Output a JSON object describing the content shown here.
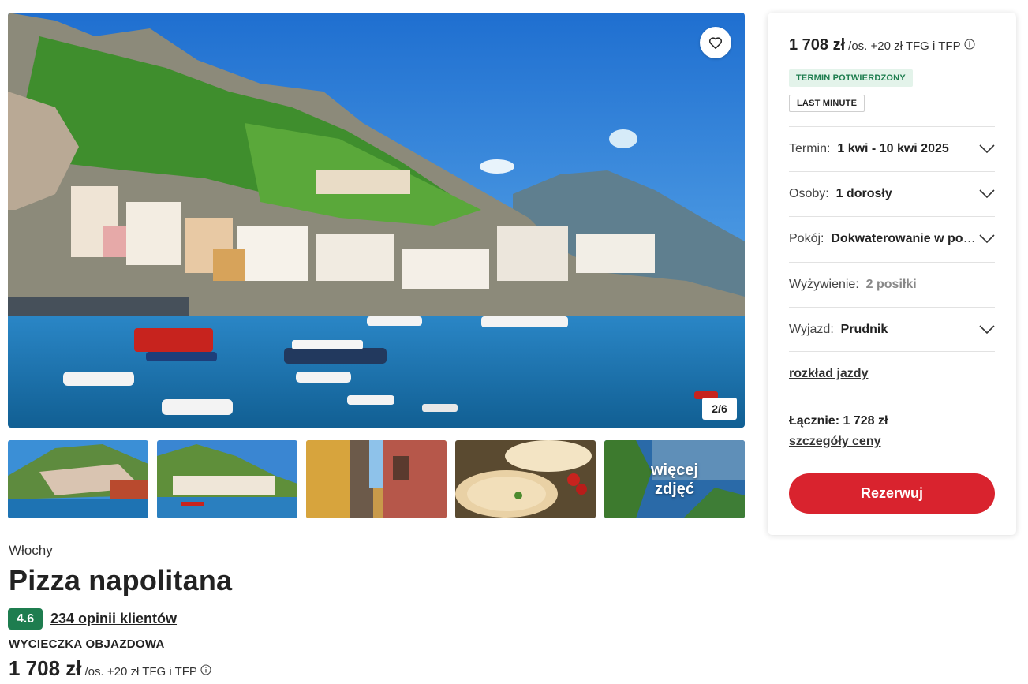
{
  "gallery": {
    "counter": "2/6",
    "more_photos_label": "więcej\nzdjęć",
    "favorite_icon": "heart-icon"
  },
  "offer": {
    "country": "Włochy",
    "title": "Pizza napolitana",
    "rating": "4.6",
    "reviews_link": "234 opinii klientów",
    "trip_type": "WYCIECZKA OBJAZDOWA",
    "price": "1 708 zł",
    "price_suffix": "/os. +20 zł TFG i TFP"
  },
  "booking": {
    "price": "1 708 zł",
    "price_suffix": "/os. +20 zł TFG i TFP",
    "tags": [
      "TERMIN POTWIERDZONY",
      "LAST MINUTE"
    ],
    "rows": [
      {
        "label": "Termin:",
        "value": "1 kwi - 10 kwi 2025",
        "dropdown": true
      },
      {
        "label": "Osoby:",
        "value": "1 dorosły",
        "dropdown": true
      },
      {
        "label": "Pokój:",
        "value": "Dokwaterowanie w pokoju",
        "dropdown": true
      },
      {
        "label": "Wyżywienie:",
        "value": "2 posiłki",
        "dropdown": false
      },
      {
        "label": "Wyjazd:",
        "value": "Prudnik",
        "dropdown": true
      }
    ],
    "schedule_link": "rozkład jazdy",
    "total": "Łącznie: 1 728 zł",
    "price_details_link": "szczegóły ceny",
    "book_button": "Rezerwuj"
  },
  "colors": {
    "accent_red": "#d9232e",
    "rating_green": "#1e7d4f",
    "tag_green_bg": "#e3f3ea"
  }
}
